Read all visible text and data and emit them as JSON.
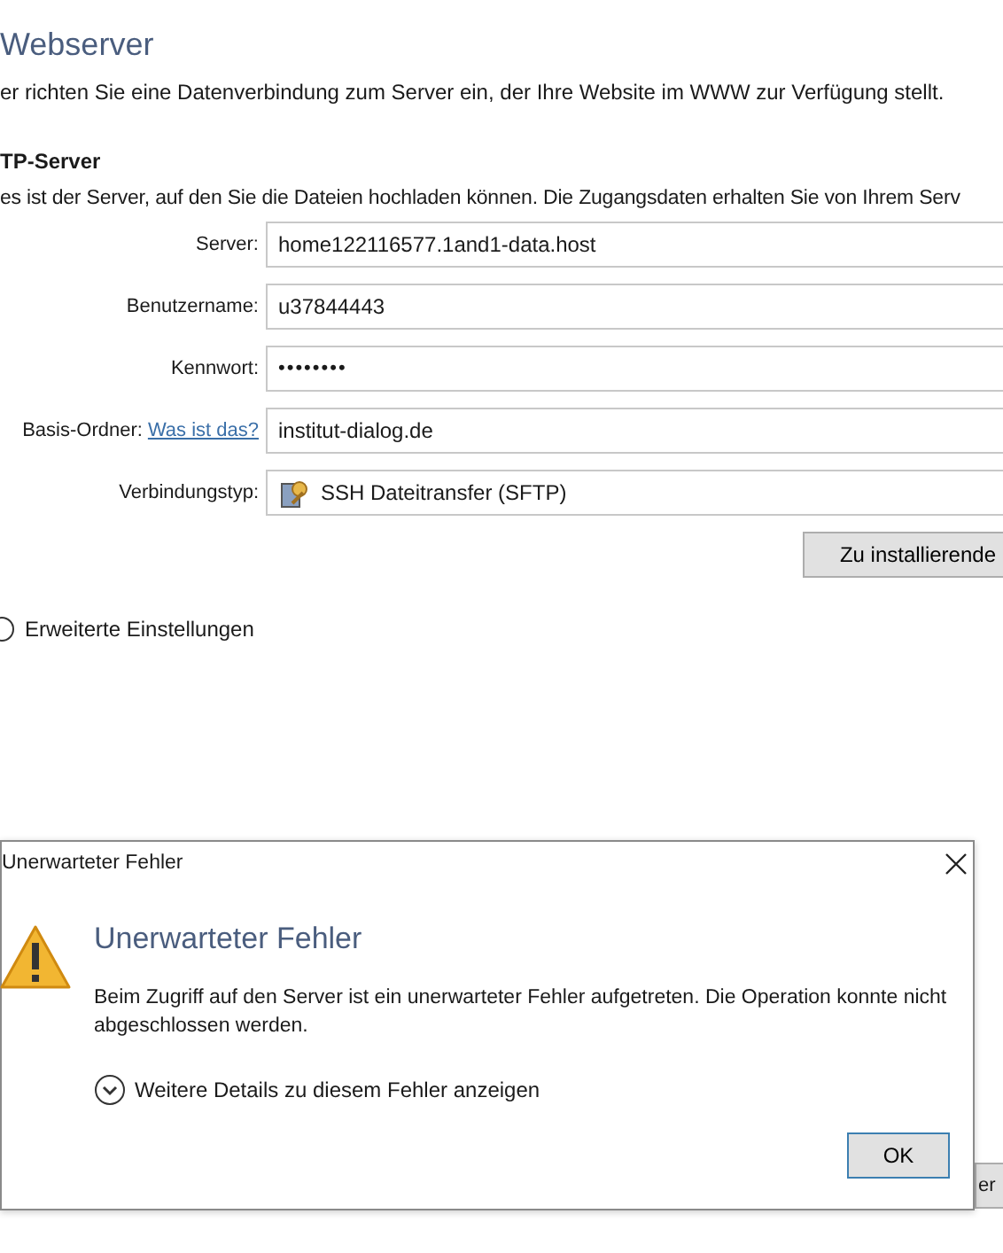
{
  "page": {
    "title": "Webserver",
    "intro": "er richten Sie eine Datenverbindung zum Server ein, der Ihre Website im WWW zur Verfügung stellt.",
    "section_title": "TP-Server",
    "section_text": "es ist der Server, auf den Sie die Dateien hochladen können. Die Zugangsdaten erhalten Sie von Ihrem Serv"
  },
  "fields": [
    {
      "label": "Server:",
      "value": "home122116577.1and1-data.host",
      "kind": "text"
    },
    {
      "label": "Benutzername:",
      "value": "u37844443",
      "kind": "text"
    },
    {
      "label": "Kennwort:",
      "value": "••••••••",
      "kind": "password"
    },
    {
      "label": "Basis-Ordner:",
      "link": "Was ist das?",
      "value": "institut-dialog.de",
      "kind": "text"
    },
    {
      "label": "Verbindungstyp:",
      "value": "SSH Dateitransfer (SFTP)",
      "kind": "select"
    }
  ],
  "install_button": "Zu installierende",
  "advanced": {
    "label": "Erweiterte Einstellungen",
    "expanded": false
  },
  "background_button": "er",
  "dialog": {
    "title": "Unerwarteter Fehler",
    "heading": "Unerwarteter Fehler",
    "message": "Beim Zugriff auf den Server ist ein unerwarteter Fehler aufgetreten. Die Operation konnte nicht abgeschlossen werden.",
    "details_toggle": {
      "label": "Weitere Details zu diesem Fehler anzeigen",
      "expanded": false
    },
    "buttons": [
      "OK"
    ]
  }
}
